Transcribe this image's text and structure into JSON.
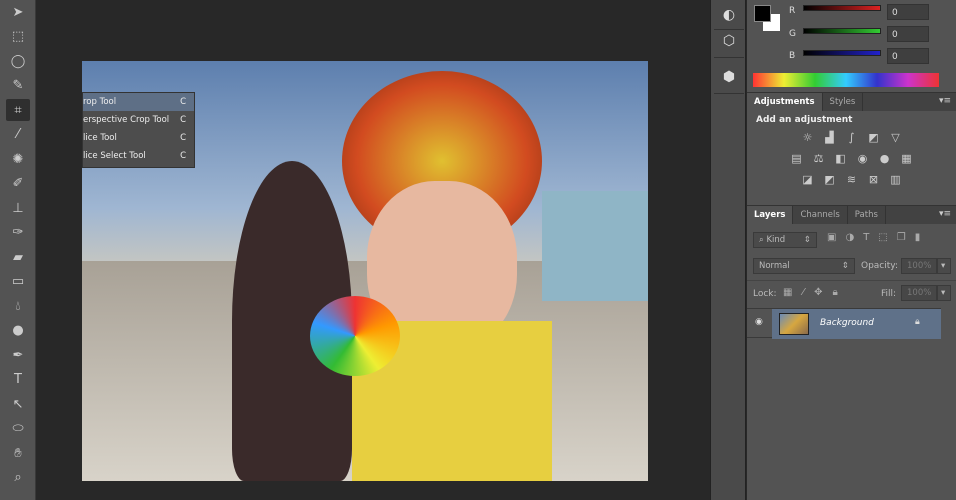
{
  "toolbar": {
    "tools": [
      "move-tool",
      "marquee-tool",
      "lasso-tool",
      "quick-selection-tool",
      "crop-tool",
      "eyedropper-tool",
      "spot-healing-tool",
      "brush-tool",
      "clone-stamp-tool",
      "history-brush-tool",
      "eraser-tool",
      "gradient-tool",
      "blur-tool",
      "dodge-tool",
      "pen-tool",
      "type-tool",
      "path-selection-tool",
      "ellipse-tool",
      "hand-tool",
      "zoom-tool"
    ],
    "active": "crop-tool"
  },
  "flyout": {
    "items": [
      {
        "label": "rop Tool",
        "key": "C"
      },
      {
        "label": "erspective Crop Tool",
        "key": "C"
      },
      {
        "label": "lice Tool",
        "key": "C"
      },
      {
        "label": "lice Select Tool",
        "key": "C"
      }
    ]
  },
  "color": {
    "r_label": "R",
    "g_label": "G",
    "b_label": "B",
    "r": "0",
    "g": "0",
    "b": "0",
    "foreground": "#000000",
    "background": "#ffffff"
  },
  "adjustments": {
    "tabs": [
      "Adjustments",
      "Styles"
    ],
    "heading": "Add an adjustment"
  },
  "layers": {
    "tabs": [
      "Layers",
      "Channels",
      "Paths"
    ],
    "filter": "Kind",
    "blend": "Normal",
    "opacity_label": "Opacity:",
    "opacity": "100%",
    "lock_label": "Lock:",
    "fill_label": "Fill:",
    "fill": "100%",
    "layer_name": "Background"
  }
}
